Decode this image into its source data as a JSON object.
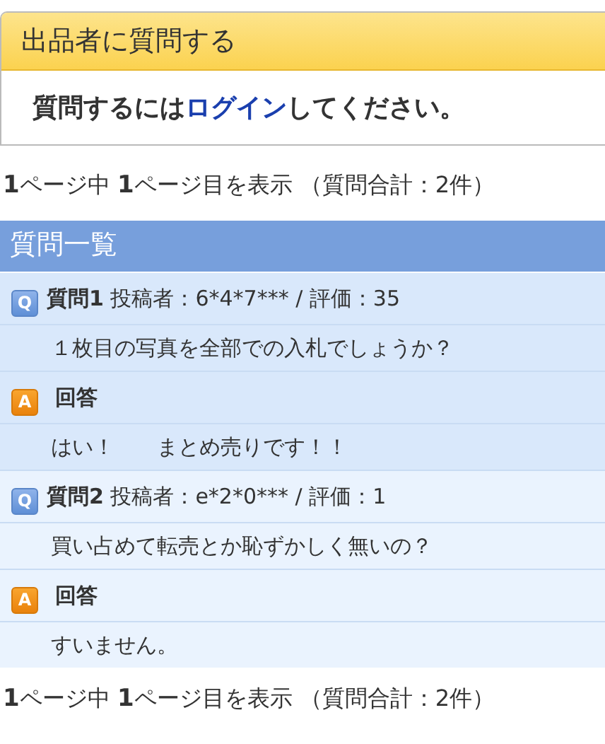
{
  "ask_panel": {
    "title": "出品者に質問する",
    "message_before": "質問するには",
    "login_link": "ログイン",
    "message_after": "してください。"
  },
  "pager_top": "**1**ページ中 **1**ページ目を表示 （質問合計：2件）",
  "question_list": {
    "title": "質問一覧",
    "items": [
      {
        "question_badge": "Q",
        "heading": "**質問1** 投稿者：6*4*7*** / 評価：35",
        "question": "１枚目の写真を全部での入札でしょうか？",
        "answer_badge": "A",
        "answer_heading": "回答",
        "answer": "はい！　　まとめ売りです！！"
      },
      {
        "question_badge": "Q",
        "heading": "**質問2** 投稿者：e*2*0*** / 評価：1",
        "question": "買い占めて転売とか恥ずかしく無いの？",
        "answer_badge": "A",
        "answer_heading": "回答",
        "answer": "すいません。"
      }
    ]
  },
  "pager_bottom": "**1**ページ中 **1**ページ目を表示 （質問合計：2件）"
}
